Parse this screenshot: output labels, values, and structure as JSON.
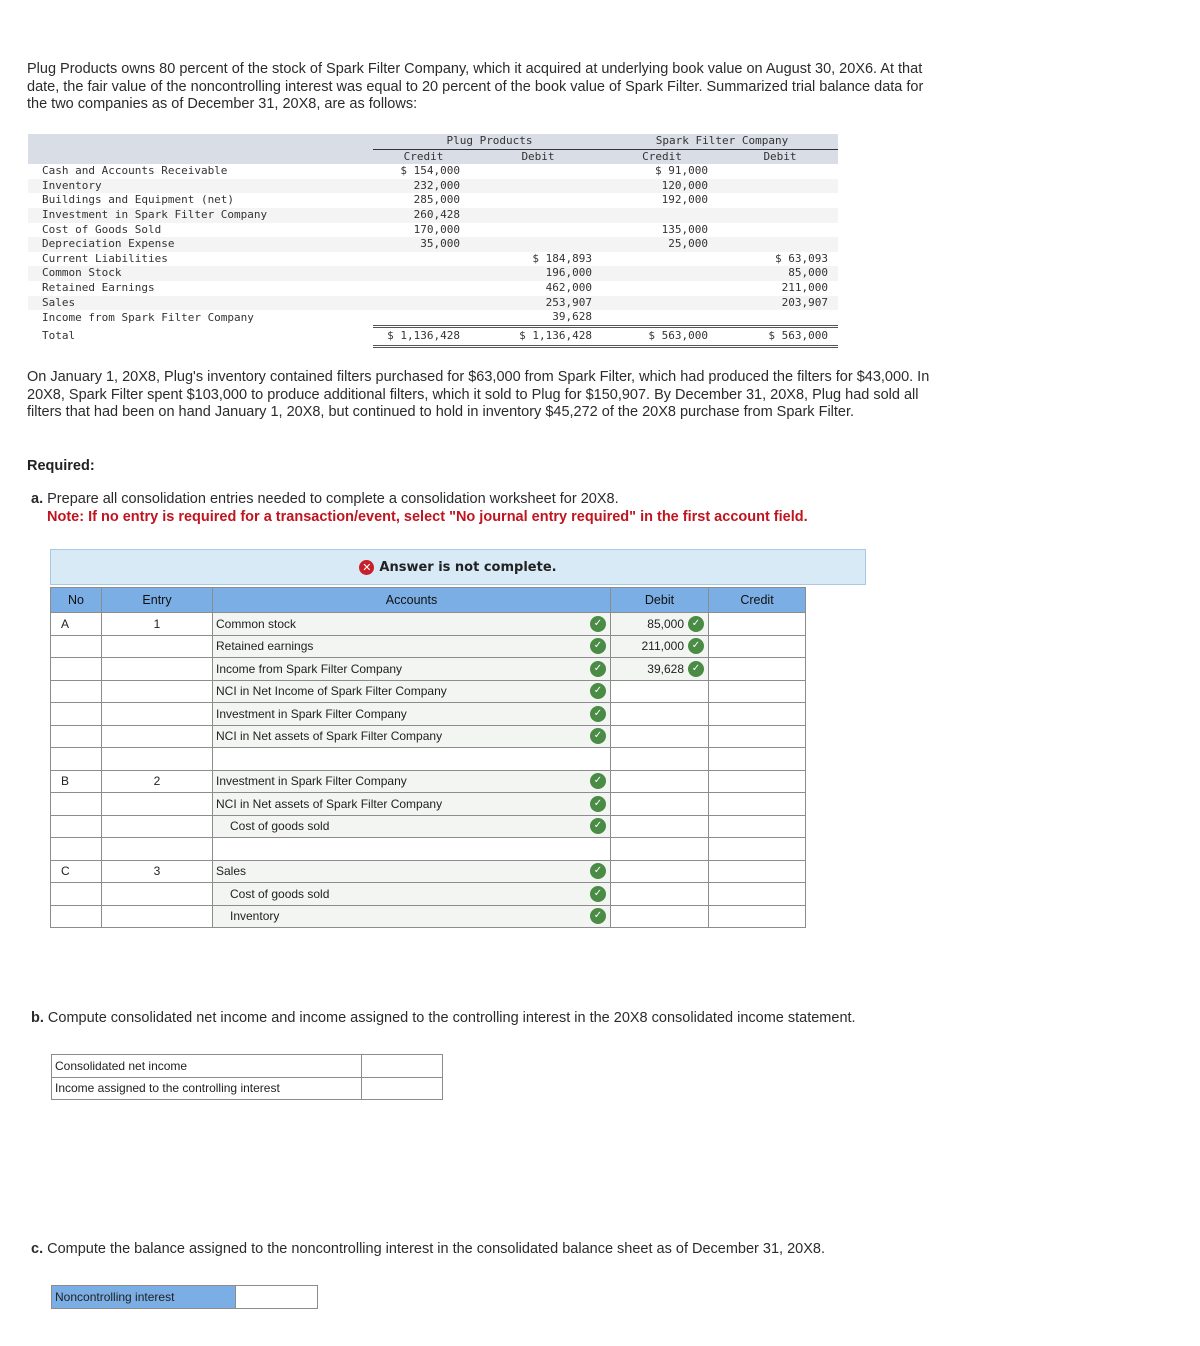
{
  "intro": "Plug Products owns 80 percent of the stock of Spark Filter Company, which it acquired at underlying book value on August 30, 20X6. At that date, the fair value of the noncontrolling interest was equal to 20 percent of the book value of Spark Filter. Summarized trial balance data for the two companies as of December 31, 20X8, are as follows:",
  "trial_balance": {
    "groups": [
      "Plug Products",
      "Spark Filter Company"
    ],
    "columns": [
      "Credit",
      "Debit",
      "Credit",
      "Debit"
    ],
    "rows": [
      {
        "label": "Cash and Accounts Receivable",
        "pc": "$ 154,000",
        "pd": "",
        "sc": "$ 91,000",
        "sd": ""
      },
      {
        "label": "Inventory",
        "pc": "232,000",
        "pd": "",
        "sc": "120,000",
        "sd": ""
      },
      {
        "label": "Buildings and Equipment (net)",
        "pc": "285,000",
        "pd": "",
        "sc": "192,000",
        "sd": ""
      },
      {
        "label": "Investment in Spark Filter Company",
        "pc": "260,428",
        "pd": "",
        "sc": "",
        "sd": ""
      },
      {
        "label": "Cost of Goods Sold",
        "pc": "170,000",
        "pd": "",
        "sc": "135,000",
        "sd": ""
      },
      {
        "label": "Depreciation Expense",
        "pc": "35,000",
        "pd": "",
        "sc": "25,000",
        "sd": ""
      },
      {
        "label": "Current Liabilities",
        "pc": "",
        "pd": "$ 184,893",
        "sc": "",
        "sd": "$ 63,093"
      },
      {
        "label": "Common Stock",
        "pc": "",
        "pd": "196,000",
        "sc": "",
        "sd": "85,000"
      },
      {
        "label": "Retained Earnings",
        "pc": "",
        "pd": "462,000",
        "sc": "",
        "sd": "211,000"
      },
      {
        "label": "Sales",
        "pc": "",
        "pd": "253,907",
        "sc": "",
        "sd": "203,907"
      },
      {
        "label": "Income from Spark Filter Company",
        "pc": "",
        "pd": "39,628",
        "sc": "",
        "sd": ""
      }
    ],
    "total": {
      "label": "Total",
      "pc": "$ 1,136,428",
      "pd": "$ 1,136,428",
      "sc": "$ 563,000",
      "sd": "$ 563,000"
    }
  },
  "details": "On January 1, 20X8, Plug's inventory contained filters purchased for $63,000 from Spark Filter, which had produced the filters for $43,000. In 20X8, Spark Filter spent $103,000 to produce additional filters, which it sold to Plug for $150,907. By December 31, 20X8, Plug had sold all filters that had been on hand January 1, 20X8, but continued to hold in inventory $45,272 of the 20X8 purchase from Spark Filter.",
  "required_label": "Required:",
  "part_a": {
    "prefix": "a.",
    "text": "Prepare all consolidation entries needed to complete a consolidation worksheet for 20X8.",
    "note": "Note: If no entry is required for a transaction/event, select \"No journal entry required\" in the first account field.",
    "banner": "Answer is not complete.",
    "headers": [
      "No",
      "Entry",
      "Accounts",
      "Debit",
      "Credit"
    ],
    "rows": [
      {
        "no": "A",
        "entry": "1",
        "account": "Common stock",
        "indent": false,
        "acct_check": true,
        "debit": "85,000",
        "debit_check": true,
        "credit": ""
      },
      {
        "no": "",
        "entry": "",
        "account": "Retained earnings",
        "indent": false,
        "acct_check": true,
        "debit": "211,000",
        "debit_check": true,
        "credit": ""
      },
      {
        "no": "",
        "entry": "",
        "account": "Income from Spark Filter Company",
        "indent": false,
        "acct_check": true,
        "debit": "39,628",
        "debit_check": true,
        "credit": ""
      },
      {
        "no": "",
        "entry": "",
        "account": "NCI in Net Income of Spark Filter Company",
        "indent": false,
        "acct_check": true,
        "debit": "",
        "debit_check": false,
        "credit": ""
      },
      {
        "no": "",
        "entry": "",
        "account": "Investment in Spark Filter Company",
        "indent": false,
        "acct_check": true,
        "debit": "",
        "debit_check": false,
        "credit": ""
      },
      {
        "no": "",
        "entry": "",
        "account": "NCI in Net assets of Spark Filter Company",
        "indent": false,
        "acct_check": true,
        "debit": "",
        "debit_check": false,
        "credit": ""
      },
      {
        "no": "",
        "entry": "",
        "account": "",
        "indent": false,
        "acct_check": false,
        "debit": "",
        "debit_check": false,
        "credit": "",
        "blank": true
      },
      {
        "no": "B",
        "entry": "2",
        "account": "Investment in Spark Filter Company",
        "indent": false,
        "acct_check": true,
        "debit": "",
        "debit_check": false,
        "credit": ""
      },
      {
        "no": "",
        "entry": "",
        "account": "NCI in Net assets of Spark Filter Company",
        "indent": false,
        "acct_check": true,
        "debit": "",
        "debit_check": false,
        "credit": ""
      },
      {
        "no": "",
        "entry": "",
        "account": "Cost of goods sold",
        "indent": true,
        "acct_check": true,
        "debit": "",
        "debit_check": false,
        "credit": ""
      },
      {
        "no": "",
        "entry": "",
        "account": "",
        "indent": false,
        "acct_check": false,
        "debit": "",
        "debit_check": false,
        "credit": "",
        "blank": true
      },
      {
        "no": "C",
        "entry": "3",
        "account": "Sales",
        "indent": false,
        "acct_check": true,
        "debit": "",
        "debit_check": false,
        "credit": ""
      },
      {
        "no": "",
        "entry": "",
        "account": "Cost of goods sold",
        "indent": true,
        "acct_check": true,
        "debit": "",
        "debit_check": false,
        "credit": ""
      },
      {
        "no": "",
        "entry": "",
        "account": "Inventory",
        "indent": true,
        "acct_check": true,
        "debit": "",
        "debit_check": false,
        "credit": ""
      }
    ]
  },
  "part_b": {
    "prefix": "b.",
    "text": "Compute consolidated net income and income assigned to the controlling interest in the 20X8 consolidated income statement.",
    "rows": [
      {
        "label": "Consolidated net income",
        "value": ""
      },
      {
        "label": "Income assigned to the controlling interest",
        "value": ""
      }
    ]
  },
  "part_c": {
    "prefix": "c.",
    "text": "Compute the balance assigned to the noncontrolling interest in the consolidated balance sheet as of December 31, 20X8.",
    "rows": [
      {
        "label": "Noncontrolling interest",
        "value": ""
      }
    ]
  },
  "icons": {
    "error": "x-circle-icon",
    "correct": "check-circle-icon"
  },
  "colors": {
    "header_blue": "#7aaee4",
    "banner_bg": "#d9eaf7",
    "note_red": "#c0141f",
    "check_green": "#4a8c45",
    "error_red": "#c8202a"
  }
}
